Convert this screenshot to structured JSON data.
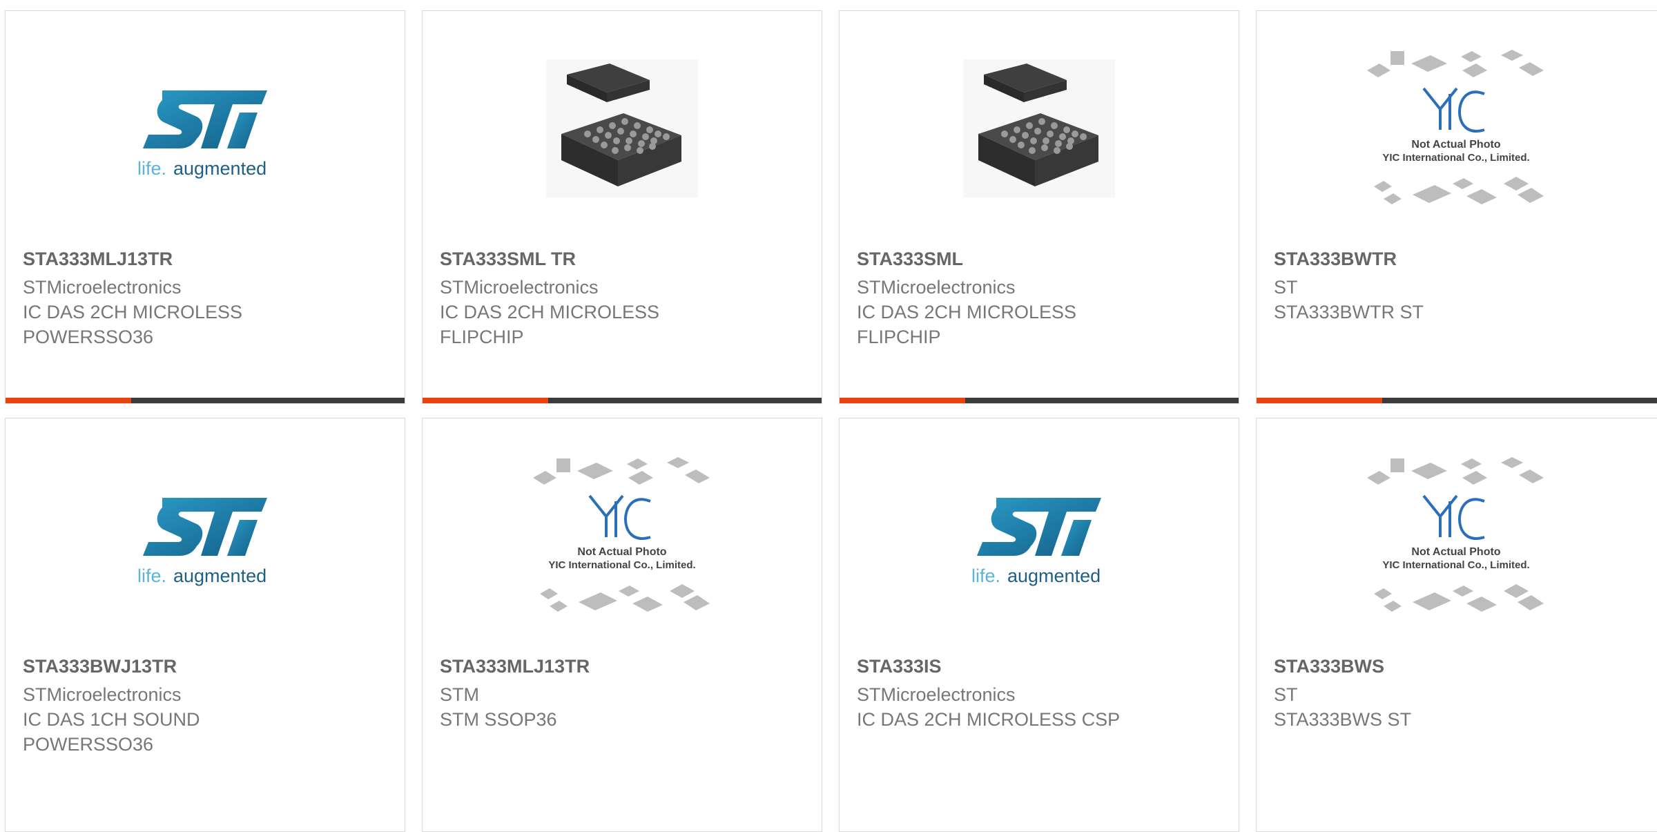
{
  "colors": {
    "accent": "#e8420e",
    "bar_dark": "#3b3b3b",
    "st_blue": "#1e7fa8",
    "yic_blue": "#2a6fb8"
  },
  "logos": {
    "st_tagline_1": "life.",
    "st_tagline_2": "augmented",
    "yic_line1": "Not Actual Photo",
    "yic_line2": "YIC International Co., Limited."
  },
  "products": [
    {
      "part": "STA333MLJ13TR",
      "manufacturer": "STMicroelectronics",
      "description": "IC DAS 2CH MICROLESS POWERSSO36",
      "image": "st-logo"
    },
    {
      "part": "STA333SML TR",
      "manufacturer": "STMicroelectronics",
      "description": "IC DAS 2CH MICROLESS FLIPCHIP",
      "image": "chip-photo"
    },
    {
      "part": "STA333SML",
      "manufacturer": "STMicroelectronics",
      "description": "IC DAS 2CH MICROLESS FLIPCHIP",
      "image": "chip-photo"
    },
    {
      "part": "STA333BWTR",
      "manufacturer": "ST",
      "description": "STA333BWTR ST",
      "image": "yic-placeholder"
    },
    {
      "part": "STA333BWJ13TR",
      "manufacturer": "STMicroelectronics",
      "description": "IC DAS 1CH SOUND POWERSSO36",
      "image": "st-logo"
    },
    {
      "part": "STA333MLJ13TR",
      "manufacturer": "STM",
      "description": "STM SSOP36",
      "image": "yic-placeholder"
    },
    {
      "part": "STA333IS",
      "manufacturer": "STMicroelectronics",
      "description": "IC DAS 2CH MICROLESS CSP",
      "image": "st-logo"
    },
    {
      "part": "STA333BWS",
      "manufacturer": "ST",
      "description": "STA333BWS ST",
      "image": "yic-placeholder"
    }
  ]
}
